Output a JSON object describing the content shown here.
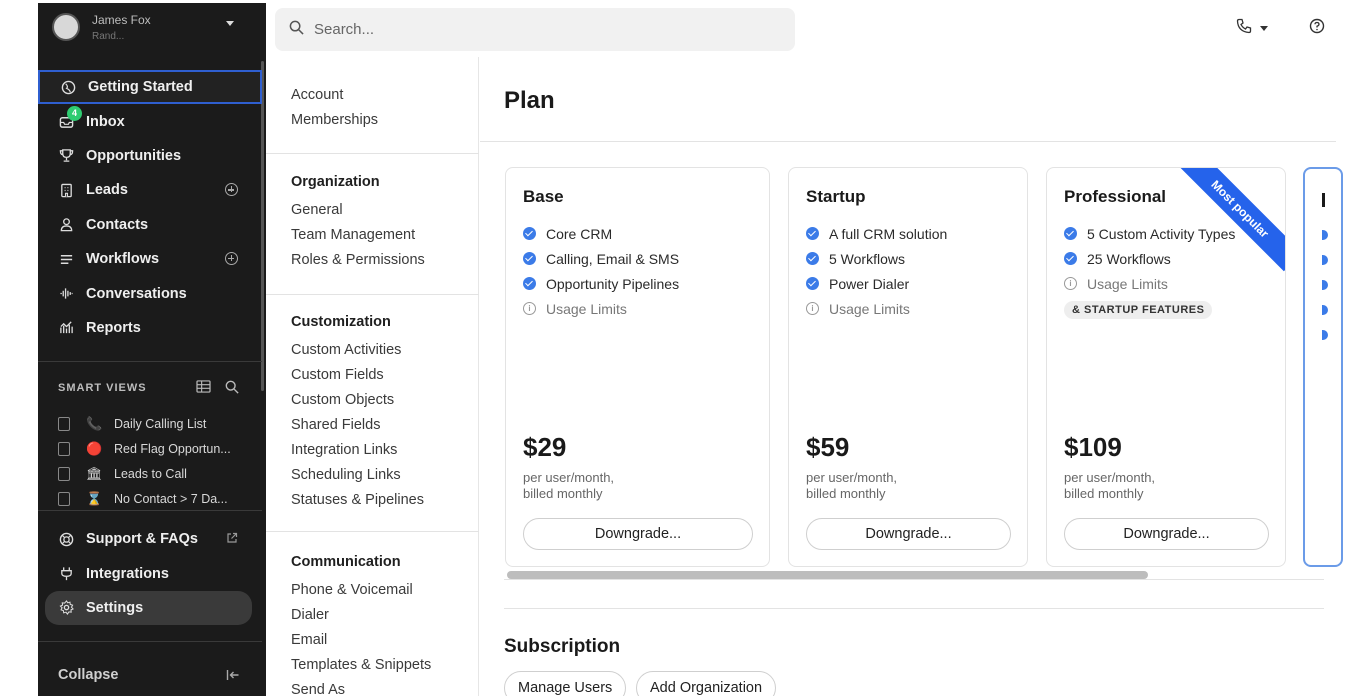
{
  "user": {
    "name": "James Fox",
    "sub": "Rand..."
  },
  "search": {
    "placeholder": "Search..."
  },
  "icons": {
    "search": "search-icon",
    "phone": "phone-icon",
    "help": "help-icon"
  },
  "sidebar": {
    "items": [
      {
        "label": "Getting Started",
        "icon": "globe-icon"
      },
      {
        "label": "Inbox",
        "icon": "inbox-icon",
        "badge": "4"
      },
      {
        "label": "Opportunities",
        "icon": "trophy-icon"
      },
      {
        "label": "Leads",
        "icon": "building-icon"
      },
      {
        "label": "Contacts",
        "icon": "person-icon"
      },
      {
        "label": "Workflows",
        "icon": "list-icon"
      },
      {
        "label": "Conversations",
        "icon": "waveform-icon"
      },
      {
        "label": "Reports",
        "icon": "chart-icon"
      }
    ],
    "smart_views_title": "SMART VIEWS",
    "smart_views": [
      {
        "emoji": "📞",
        "label": "Daily Calling List"
      },
      {
        "emoji": "🔴",
        "label": "Red Flag Opportun..."
      },
      {
        "emoji": "🏛",
        "label": "Leads to Call"
      },
      {
        "emoji": "⌛",
        "label": "No Contact > 7 Da..."
      }
    ],
    "bottom": [
      {
        "label": "Support & FAQs"
      },
      {
        "label": "Integrations"
      },
      {
        "label": "Settings"
      }
    ],
    "collapse": "Collapse"
  },
  "settings_nav": {
    "top": [
      "Account",
      "Memberships"
    ],
    "groups": [
      {
        "title": "Organization",
        "links": [
          "General",
          "Team Management",
          "Roles & Permissions"
        ]
      },
      {
        "title": "Customization",
        "links": [
          "Custom Activities",
          "Custom Fields",
          "Custom Objects",
          "Shared Fields",
          "Integration Links",
          "Scheduling Links",
          "Statuses & Pipelines"
        ]
      },
      {
        "title": "Communication",
        "links": [
          "Phone & Voicemail",
          "Dialer",
          "Email",
          "Templates & Snippets",
          "Send As"
        ]
      }
    ]
  },
  "main": {
    "title": "Plan",
    "plans": [
      {
        "name": "Base",
        "features": [
          "Core CRM",
          "Calling, Email & SMS",
          "Opportunity Pipelines"
        ],
        "limits": "Usage Limits",
        "price": "$29",
        "per1": "per user/month,",
        "per2": "billed monthly",
        "button": "Downgrade..."
      },
      {
        "name": "Startup",
        "features": [
          "A full CRM solution",
          "5 Workflows",
          "Power Dialer"
        ],
        "limits": "Usage Limits",
        "price": "$59",
        "per1": "per user/month,",
        "per2": "billed monthly",
        "button": "Downgrade..."
      },
      {
        "name": "Professional",
        "features": [
          "5 Custom Activity Types",
          "25 Workflows"
        ],
        "limits": "Usage Limits",
        "tag": "& STARTUP FEATURES",
        "ribbon": "Most popular",
        "price": "$109",
        "per1": "per user/month,",
        "per2": "billed monthly",
        "button": "Downgrade..."
      }
    ],
    "subscription_title": "Subscription",
    "subscription_buttons": [
      "Manage Users",
      "Add Organization"
    ]
  }
}
